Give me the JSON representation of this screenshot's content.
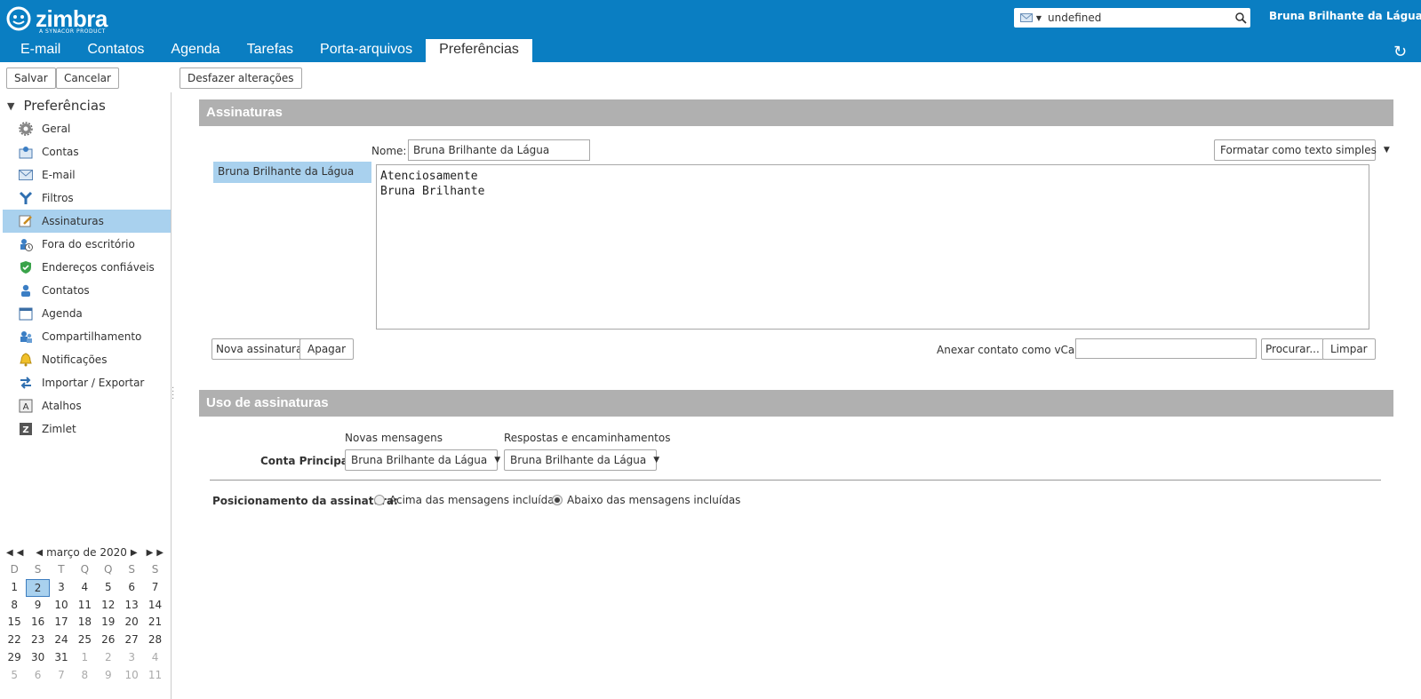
{
  "app": {
    "logo": "zimbra",
    "logo_sub": "A SYNACOR PRODUCT",
    "search_value": "undefined",
    "user_name": "Bruna Brilhante da Lágua"
  },
  "tabs": [
    {
      "label": "E-mail"
    },
    {
      "label": "Contatos"
    },
    {
      "label": "Agenda"
    },
    {
      "label": "Tarefas"
    },
    {
      "label": "Porta-arquivos"
    },
    {
      "label": "Preferências"
    }
  ],
  "toolbar": {
    "save": "Salvar",
    "cancel": "Cancelar",
    "undo": "Desfazer alterações"
  },
  "sidebar": {
    "root": "Preferências",
    "items": [
      {
        "label": "Geral",
        "icon": "gear-icon"
      },
      {
        "label": "Contas",
        "icon": "accounts-icon"
      },
      {
        "label": "E-mail",
        "icon": "envelope-icon"
      },
      {
        "label": "Filtros",
        "icon": "filter-icon"
      },
      {
        "label": "Assinaturas",
        "icon": "signature-icon"
      },
      {
        "label": "Fora do escritório",
        "icon": "out-of-office-icon"
      },
      {
        "label": "Endereços confiáveis",
        "icon": "shield-icon"
      },
      {
        "label": "Contatos",
        "icon": "person-icon"
      },
      {
        "label": "Agenda",
        "icon": "calendar-icon"
      },
      {
        "label": "Compartilhamento",
        "icon": "share-icon"
      },
      {
        "label": "Notificações",
        "icon": "bell-icon"
      },
      {
        "label": "Importar / Exportar",
        "icon": "import-export-icon"
      },
      {
        "label": "Atalhos",
        "icon": "shortcut-icon"
      },
      {
        "label": "Zimlet",
        "icon": "zimlet-icon"
      }
    ]
  },
  "calendar": {
    "title": "março de 2020",
    "days_of_week": [
      "D",
      "S",
      "T",
      "Q",
      "Q",
      "S",
      "S"
    ],
    "weeks": [
      [
        "1",
        "2",
        "3",
        "4",
        "5",
        "6",
        "7"
      ],
      [
        "8",
        "9",
        "10",
        "11",
        "12",
        "13",
        "14"
      ],
      [
        "15",
        "16",
        "17",
        "18",
        "19",
        "20",
        "21"
      ],
      [
        "22",
        "23",
        "24",
        "25",
        "26",
        "27",
        "28"
      ],
      [
        "29",
        "30",
        "31",
        "1",
        "2",
        "3",
        "4"
      ],
      [
        "5",
        "6",
        "7",
        "8",
        "9",
        "10",
        "11"
      ]
    ],
    "selected_day": "2"
  },
  "signatures": {
    "section_title": "Assinaturas",
    "name_label": "Nome:",
    "name_value": "Bruna Brilhante da Lágua",
    "format_option": "Formatar como texto simples",
    "list": [
      "Bruna Brilhante da Lágua"
    ],
    "text": "Atenciosamente\nBruna Brilhante",
    "new_button": "Nova assinatura",
    "delete_button": "Apagar",
    "vcard_label": "Anexar contato como vCard:",
    "vcard_value": "",
    "browse_button": "Procurar...",
    "clear_button": "Limpar"
  },
  "usage": {
    "section_title": "Uso de assinaturas",
    "col_new": "Novas mensagens",
    "col_reply": "Respostas e encaminhamentos",
    "account_label": "Conta Principal:",
    "new_value": "Bruna Brilhante da Lágua",
    "reply_value": "Bruna Brilhante da Lágua",
    "position_label": "Posicionamento da assinatura:",
    "option_above": "Acima das mensagens incluídas",
    "option_below": "Abaixo das mensagens incluídas",
    "selected": "below"
  }
}
